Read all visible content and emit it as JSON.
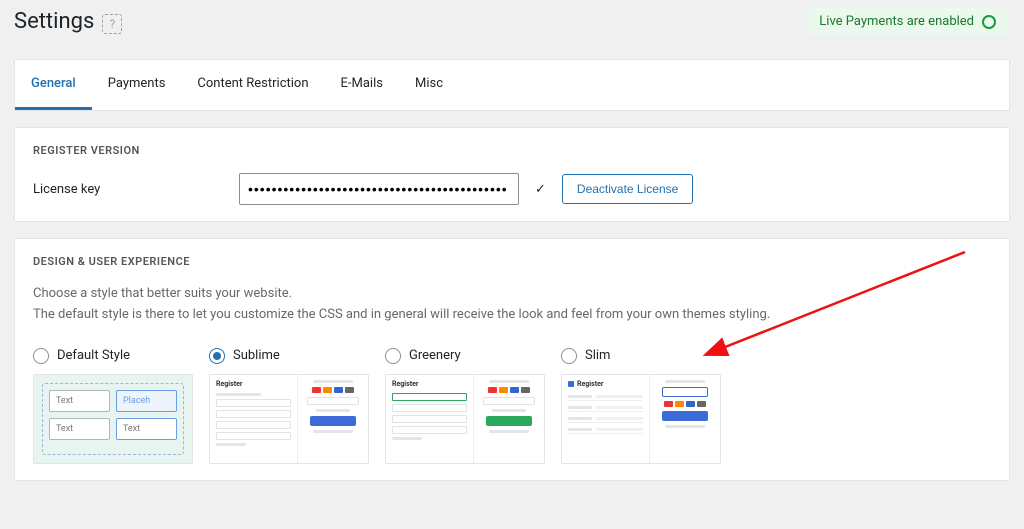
{
  "header": {
    "title": "Settings",
    "help_icon_label": "?",
    "live_payments_label": "Live Payments are enabled"
  },
  "tabs": {
    "items": [
      {
        "label": "General",
        "active": true
      },
      {
        "label": "Payments",
        "active": false
      },
      {
        "label": "Content Restriction",
        "active": false
      },
      {
        "label": "E-Mails",
        "active": false
      },
      {
        "label": "Misc",
        "active": false
      }
    ]
  },
  "license_section": {
    "heading": "REGISTER VERSION",
    "label": "License key",
    "value": "••••••••••••••••••••••••••••••••••••••••••••",
    "check_icon": "✓",
    "deactivate_label": "Deactivate License"
  },
  "design_section": {
    "heading": "DESIGN & USER EXPERIENCE",
    "desc_line1": "Choose a style that better suits your website.",
    "desc_line2": "The default style is there to let you customize the CSS and in general will receive the look and feel from your own themes styling.",
    "options": [
      {
        "label": "Default Style",
        "checked": false
      },
      {
        "label": "Sublime",
        "checked": true
      },
      {
        "label": "Greenery",
        "checked": false
      },
      {
        "label": "Slim",
        "checked": false
      }
    ],
    "preview_strings": {
      "text": "Text",
      "placeholder": "Placeh",
      "register": "Register"
    }
  }
}
